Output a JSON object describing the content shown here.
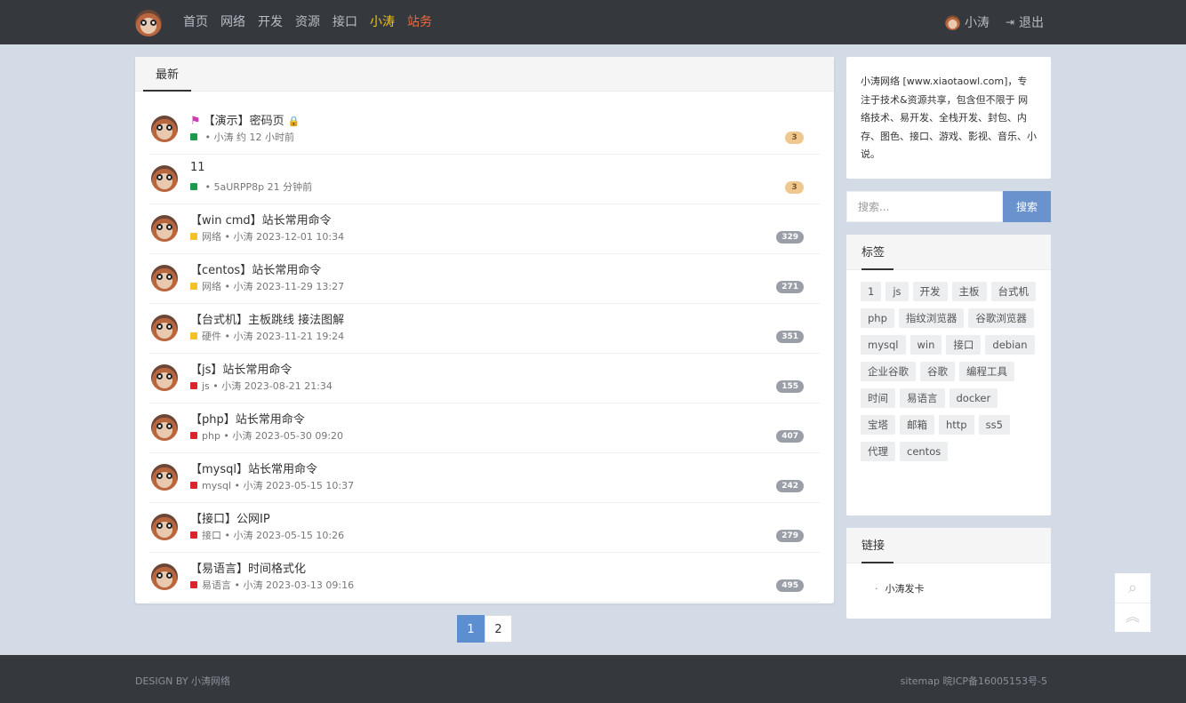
{
  "nav": {
    "items": [
      {
        "label": "首页",
        "color": "#b9bcc2"
      },
      {
        "label": "网络",
        "color": "#b9bcc2"
      },
      {
        "label": "开发",
        "color": "#b9bcc2"
      },
      {
        "label": "资源",
        "color": "#b9bcc2"
      },
      {
        "label": "接口",
        "color": "#b9bcc2"
      },
      {
        "label": "小涛",
        "color": "#f0c419"
      },
      {
        "label": "站务",
        "color": "#f06a3d"
      }
    ],
    "user_name": "小涛",
    "logout_label": "退出"
  },
  "main": {
    "tab_label": "最新",
    "posts": [
      {
        "title": "【演示】密码页",
        "flag": true,
        "locked": true,
        "category": "",
        "dot_color": "#1a9b4b",
        "author": "小涛",
        "time": "约 12 小时前",
        "count": "3",
        "hot": true
      },
      {
        "title": "11",
        "flag": false,
        "locked": false,
        "category": "",
        "dot_color": "#1a9b4b",
        "author": "5aURPP8p",
        "time": "21 分钟前",
        "count": "3",
        "hot": true
      },
      {
        "title": "【win cmd】站长常用命令",
        "flag": false,
        "locked": false,
        "category": "网络",
        "dot_color": "#f1c02a",
        "author": "小涛",
        "time": "2023-12-01 10:34",
        "count": "329",
        "hot": false
      },
      {
        "title": "【centos】站长常用命令",
        "flag": false,
        "locked": false,
        "category": "网络",
        "dot_color": "#f1c02a",
        "author": "小涛",
        "time": "2023-11-29 13:27",
        "count": "271",
        "hot": false
      },
      {
        "title": "【台式机】主板跳线 接法图解",
        "flag": false,
        "locked": false,
        "category": "硬件",
        "dot_color": "#f1c02a",
        "author": "小涛",
        "time": "2023-11-21 19:24",
        "count": "351",
        "hot": false
      },
      {
        "title": "【js】站长常用命令",
        "flag": false,
        "locked": false,
        "category": "js",
        "dot_color": "#d9262e",
        "author": "小涛",
        "time": "2023-08-21 21:34",
        "count": "155",
        "hot": false
      },
      {
        "title": "【php】站长常用命令",
        "flag": false,
        "locked": false,
        "category": "php",
        "dot_color": "#d9262e",
        "author": "小涛",
        "time": "2023-05-30 09:20",
        "count": "407",
        "hot": false
      },
      {
        "title": "【mysql】站长常用命令",
        "flag": false,
        "locked": false,
        "category": "mysql",
        "dot_color": "#d9262e",
        "author": "小涛",
        "time": "2023-05-15 10:37",
        "count": "242",
        "hot": false
      },
      {
        "title": "【接口】公网IP",
        "flag": false,
        "locked": false,
        "category": "接口",
        "dot_color": "#d9262e",
        "author": "小涛",
        "time": "2023-05-15 10:26",
        "count": "279",
        "hot": false
      },
      {
        "title": "【易语言】时间格式化",
        "flag": false,
        "locked": false,
        "category": "易语言",
        "dot_color": "#d9262e",
        "author": "小涛",
        "time": "2023-03-13 09:16",
        "count": "495",
        "hot": false
      }
    ]
  },
  "pager": {
    "pages": [
      "1",
      "2"
    ],
    "active": "1"
  },
  "sidebar": {
    "about": "小涛网络 [www.xiaotaowl.com]，专注于技术&资源共享，包含但不限于 网络技术、易开发、全栈开发、封包、内存、图色、接口、游戏、影视、音乐、小说。",
    "search_placeholder": "搜索...",
    "search_button": "搜索",
    "tags_title": "标签",
    "tags": [
      "1",
      "js",
      "开发",
      "主板",
      "台式机",
      "php",
      "指纹浏览器",
      "谷歌浏览器",
      "mysql",
      "win",
      "接口",
      "debian",
      "企业谷歌",
      "谷歌",
      "编程工具",
      "时间",
      "易语言",
      "docker",
      "宝塔",
      "邮箱",
      "http",
      "ss5",
      "代理",
      "centos"
    ],
    "links_title": "链接",
    "links": [
      "小涛发卡"
    ]
  },
  "footer": {
    "left": "DESIGN BY 小涛网络",
    "right": "sitemap  晥ICP备16005153号-5"
  }
}
